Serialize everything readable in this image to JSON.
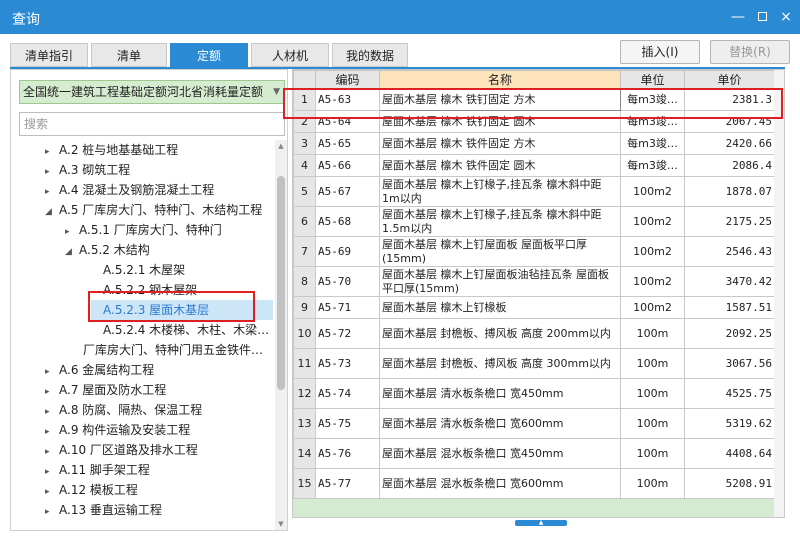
{
  "window": {
    "title": "查询",
    "minimize": "—",
    "close": "×"
  },
  "tabs": [
    "清单指引",
    "清单",
    "定额",
    "人材机",
    "我的数据"
  ],
  "buttons": {
    "insert": "插入(I)",
    "replace": "替换(R)"
  },
  "quota_select": {
    "value": "全国统一建筑工程基础定额河北省消耗量定额"
  },
  "search": {
    "placeholder": "搜索"
  },
  "tree": [
    {
      "label": "A.2 桩与地基基础工程",
      "expand": "▸"
    },
    {
      "label": "A.3 砌筑工程",
      "expand": "▸"
    },
    {
      "label": "A.4 混凝土及钢筋混凝土工程",
      "expand": "▸"
    },
    {
      "label": "A.5 厂库房大门、特种门、木结构工程",
      "expand": "◢"
    },
    {
      "label": "A.5.1 厂库房大门、特种门",
      "expand": "▸"
    },
    {
      "label": "A.5.2 木结构",
      "expand": "◢"
    },
    {
      "label": "A.5.2.1 木屋架",
      "expand": ""
    },
    {
      "label": "A.5.2.2 钢木屋架",
      "expand": ""
    },
    {
      "label": "A.5.2.3 屋面木基层",
      "expand": ""
    },
    {
      "label": "A.5.2.4 木楼梯、木柱、木梁…",
      "expand": ""
    },
    {
      "label": "厂库房大门、特种门用五金铁件…",
      "expand": ""
    },
    {
      "label": "A.6 金属结构工程",
      "expand": "▸"
    },
    {
      "label": "A.7 屋面及防水工程",
      "expand": "▸"
    },
    {
      "label": "A.8 防腐、隔热、保温工程",
      "expand": "▸"
    },
    {
      "label": "A.9 构件运输及安装工程",
      "expand": "▸"
    },
    {
      "label": "A.10 厂区道路及排水工程",
      "expand": "▸"
    },
    {
      "label": "A.11 脚手架工程",
      "expand": "▸"
    },
    {
      "label": "A.12 模板工程",
      "expand": "▸"
    },
    {
      "label": "A.13 垂直运输工程",
      "expand": "▸"
    }
  ],
  "table": {
    "headers": [
      "",
      "编码",
      "名称",
      "单位",
      "单价"
    ],
    "rows": [
      {
        "num": "1",
        "code": "A5-63",
        "name": "屋面木基层 檩木 铁钉固定 方木",
        "unit": "每m3竣…",
        "price": "2381.3"
      },
      {
        "num": "2",
        "code": "A5-64",
        "name": "屋面木基层 檩木 铁钉固定 圆木",
        "unit": "每m3竣…",
        "price": "2067.45"
      },
      {
        "num": "3",
        "code": "A5-65",
        "name": "屋面木基层 檩木 铁件固定 方木",
        "unit": "每m3竣…",
        "price": "2420.66"
      },
      {
        "num": "4",
        "code": "A5-66",
        "name": "屋面木基层 檩木 铁件固定 圆木",
        "unit": "每m3竣…",
        "price": "2086.4"
      },
      {
        "num": "5",
        "code": "A5-67",
        "name": "屋面木基层 檩木上钉椽子,挂瓦条 檩木斜中距 1m以内",
        "unit": "100m2",
        "price": "1878.07"
      },
      {
        "num": "6",
        "code": "A5-68",
        "name": "屋面木基层 檩木上钉椽子,挂瓦条 檩木斜中距 1.5m以内",
        "unit": "100m2",
        "price": "2175.25"
      },
      {
        "num": "7",
        "code": "A5-69",
        "name": "屋面木基层 檩木上钉屋面板 屋面板平口厚(15mm)",
        "unit": "100m2",
        "price": "2546.43"
      },
      {
        "num": "8",
        "code": "A5-70",
        "name": "屋面木基层 檩木上钉屋面板油毡挂瓦条 屋面板平口厚(15mm)",
        "unit": "100m2",
        "price": "3470.42"
      },
      {
        "num": "9",
        "code": "A5-71",
        "name": "屋面木基层 檩木上钉椽板",
        "unit": "100m2",
        "price": "1587.51"
      },
      {
        "num": "10",
        "code": "A5-72",
        "name": "屋面木基层 封檐板、搏风板 高度 200mm以内",
        "unit": "100m",
        "price": "2092.25"
      },
      {
        "num": "11",
        "code": "A5-73",
        "name": "屋面木基层 封檐板、搏风板 高度 300mm以内",
        "unit": "100m",
        "price": "3067.56"
      },
      {
        "num": "12",
        "code": "A5-74",
        "name": "屋面木基层 清水板条檐口 宽450mm",
        "unit": "100m",
        "price": "4525.75"
      },
      {
        "num": "13",
        "code": "A5-75",
        "name": "屋面木基层 清水板条檐口 宽600mm",
        "unit": "100m",
        "price": "5319.62"
      },
      {
        "num": "14",
        "code": "A5-76",
        "name": "屋面木基层 混水板条檐口 宽450mm",
        "unit": "100m",
        "price": "4408.64"
      },
      {
        "num": "15",
        "code": "A5-77",
        "name": "屋面木基层 混水板条檐口 宽600mm",
        "unit": "100m",
        "price": "5208.91"
      }
    ]
  },
  "colors": {
    "accent": "#2a8ad4",
    "highlight": "#e02020",
    "select_bg": "#d6ecd0"
  }
}
